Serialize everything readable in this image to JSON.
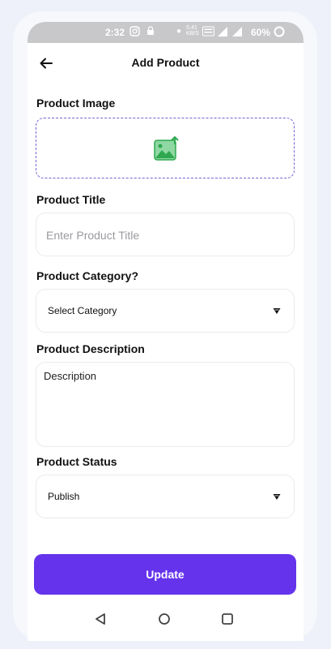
{
  "status_bar": {
    "time": "2:32",
    "speed": "0.41 KB/S",
    "battery": "60%",
    "icons": [
      "instagram-icon",
      "lock-icon",
      "dot-icon",
      "volte-icon",
      "signal-icon",
      "battery-icon"
    ]
  },
  "header": {
    "title": "Add Product",
    "back_icon": "arrow-left-icon"
  },
  "form": {
    "image_label": "Product Image",
    "image_icon": "image-upload-icon",
    "title_label": "Product Title",
    "title_placeholder": "Enter Product Title",
    "title_value": "",
    "category_label": "Product Category?",
    "category_value": "Select Category",
    "description_label": "Product Description",
    "description_placeholder": "Description",
    "description_value": "",
    "status_label": "Product Status",
    "status_value": "Publish"
  },
  "actions": {
    "update_label": "Update"
  },
  "nav": {
    "icons": [
      "back-triangle-icon",
      "home-circle-icon",
      "recents-square-icon"
    ]
  },
  "colors": {
    "accent": "#6533ec",
    "dashed_border": "#7b5fd9",
    "icon_green": "#2fa84f",
    "status_bar": "#c8c8cb"
  }
}
